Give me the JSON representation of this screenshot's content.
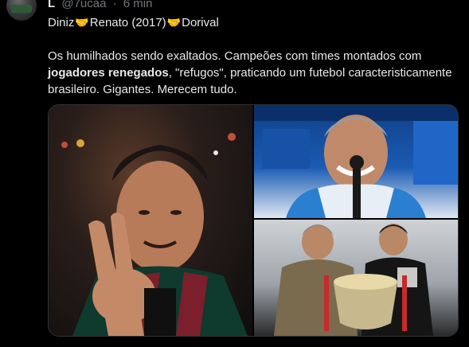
{
  "header": {
    "name": "L",
    "handle": "@7ucaa",
    "dot": "·",
    "time": "6 min"
  },
  "first_line": {
    "part1": "Diniz",
    "part2": "Renato (2017)",
    "part3": "Dorival",
    "emoji": "🤝"
  },
  "paragraph": {
    "t1": "Os humilhados sendo exaltados. Campeões com times montados com ",
    "bold": "jogadores renegados",
    "t2": ", \"refugos\", praticando um futebol caracteristicamente brasileiro. Gigantes. Merecem tudo."
  },
  "media": {
    "left_caption": "",
    "tr_caption": "",
    "br_caption": ""
  },
  "colors": {
    "background": "#000000",
    "text": "#e7e9ea",
    "muted": "#71767b",
    "border": "#2f3336"
  }
}
